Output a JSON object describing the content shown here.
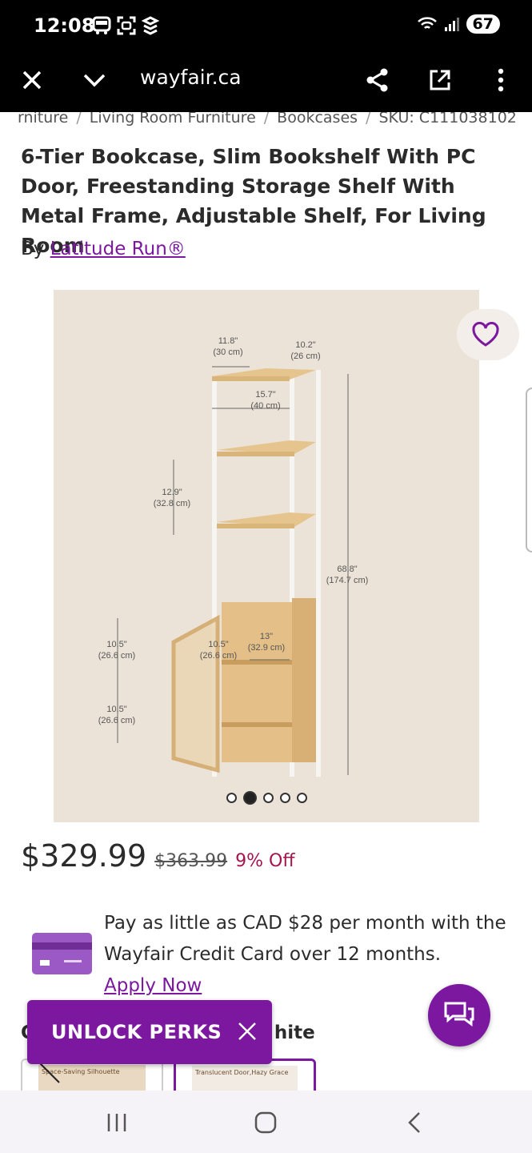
{
  "status": {
    "time": "12:08",
    "battery": "67"
  },
  "browser": {
    "url": "wayfair.ca"
  },
  "breadcrumb": [
    "rniture",
    "Living Room Furniture",
    "Bookcases",
    "SKU: C111038102"
  ],
  "product": {
    "title": "6-Tier Bookcase, Slim Bookshelf With PC Door, Freestanding Storage Shelf With Metal Frame, Adjustable Shelf, For Living Room",
    "by_label": "By",
    "brand": "Latitude Run®"
  },
  "image": {
    "dims": {
      "d1": "11.8\"",
      "d1m": "(30 cm)",
      "d2": "10.2\"",
      "d2m": "(26 cm)",
      "d3": "15.7\"",
      "d3m": "(40 cm)",
      "d4": "12.9\"",
      "d4m": "(32.8 cm)",
      "d5": "68.8\"",
      "d5m": "(174.7 cm)",
      "d6": "10.5\"",
      "d6m": "(26.6 cm)",
      "d7": "10.5\"",
      "d7m": "(26.6 cm)",
      "d8": "13\"",
      "d8m": "(32.9 cm)",
      "d9": "10.5\"",
      "d9m": "(26.6 cm)"
    },
    "carousel_count": 5,
    "carousel_active": 2
  },
  "pricing": {
    "price": "$329.99",
    "old_price": "$363.99",
    "discount": "9% Off"
  },
  "credit": {
    "text": "Pay as little as CAD $28 per month with the Wayfair Credit Card over 12 months.",
    "link": "Apply Now"
  },
  "color": {
    "label_start": "C",
    "label_end": "hite"
  },
  "perks": {
    "label": "UNLOCK PERKS"
  },
  "swatches": [
    {
      "label": "Space-Saving Silhouette"
    },
    {
      "label": "Translucent Door,Hazy Grace"
    }
  ],
  "colors": {
    "accent": "#7b189f",
    "discount": "#a31551",
    "image_bg": "#ece3d8"
  }
}
